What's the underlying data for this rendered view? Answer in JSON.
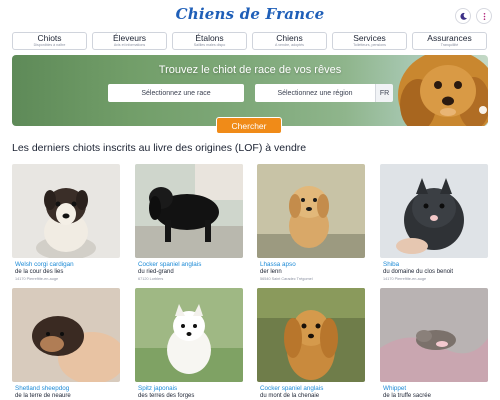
{
  "header": {
    "logo": "Chiens de France",
    "theme_icon": "moon-icon",
    "menu_icon": "more-vertical-icon"
  },
  "nav": [
    {
      "label": "Chiots",
      "sub": "Disponibles à naître"
    },
    {
      "label": "Éleveurs",
      "sub": "Avis et informations"
    },
    {
      "label": "Étalons",
      "sub": "Saillies males dispo"
    },
    {
      "label": "Chiens",
      "sub": "A vendre, adoptés"
    },
    {
      "label": "Services",
      "sub": "Toiletteurs, pensions"
    },
    {
      "label": "Assurances",
      "sub": "Tranquillité"
    }
  ],
  "hero": {
    "title": "Trouvez le chiot de race de vos rêves",
    "breed_placeholder": "Sélectionnez une race",
    "region_placeholder": "Sélectionnez une région",
    "lang": "FR",
    "search_label": "Chercher"
  },
  "section_title": "Les derniers chiots inscrits au livre des origines (LOF) à vendre",
  "puppies": [
    {
      "breed": "Welsh corgi cardigan",
      "kennel": "de la cour des lies",
      "location": "14170 Pierrefitte-en-auge"
    },
    {
      "breed": "Cocker spaniel anglais",
      "kennel": "du ried-grand",
      "location": "67120 Lorblers"
    },
    {
      "breed": "Lhassa apso",
      "kennel": "der lenn",
      "location": "56540 Saint Caradec Trégomel"
    },
    {
      "breed": "Shiba",
      "kennel": "du domaine du clos benoit",
      "location": "14170 Pierrefitte-en-auge"
    },
    {
      "breed": "Shetland sheepdog",
      "kennel": "de la terre de neaure",
      "location": ""
    },
    {
      "breed": "Spitz japonais",
      "kennel": "des terres des forges",
      "location": ""
    },
    {
      "breed": "Cocker spaniel anglais",
      "kennel": "du mont de la chenaie",
      "location": ""
    },
    {
      "breed": "Whippet",
      "kennel": "de la truffe sacrée",
      "location": ""
    }
  ],
  "colors": {
    "logo": "#1f5fb8",
    "accent_orange": "#f08b18",
    "breed_link": "#1c8ad6",
    "hero_green": "#729e69"
  }
}
